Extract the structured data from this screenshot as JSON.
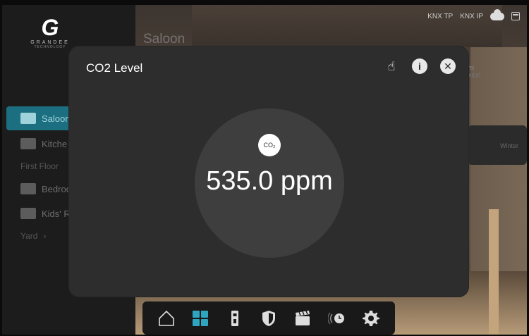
{
  "app": {
    "brand_mark": "G",
    "brand_name": "GRANDEE",
    "brand_tagline": "TECHNOLOGY",
    "status": {
      "knx_tp": "KNX TP",
      "knx_ip": "KNX IP"
    }
  },
  "background": {
    "room_title": "Saloon",
    "partial_label": "m",
    "partial_sublabel": "XIDE",
    "card_label": "Winter"
  },
  "sidebar": {
    "items": [
      {
        "label": "Saloon",
        "icon": "sofa-person-icon",
        "active": true
      },
      {
        "label": "Kitche",
        "icon": "kitchen-icon",
        "active": false
      }
    ],
    "sections": [
      {
        "label": "First Floor"
      }
    ],
    "items_first_floor": [
      {
        "label": "Bedroo",
        "icon": "bed-icon"
      },
      {
        "label": "Kids' R",
        "icon": "kids-icon"
      }
    ],
    "yard": {
      "label": "Yard",
      "chevron": "chevron-right-icon"
    },
    "accent": "#1c6f80"
  },
  "dock": {
    "items": [
      {
        "icon": "home-icon"
      },
      {
        "icon": "grid-icon",
        "active": true
      },
      {
        "icon": "door-panel-icon"
      },
      {
        "icon": "shield-icon"
      },
      {
        "icon": "clapperboard-icon"
      },
      {
        "icon": "schedule-icon"
      },
      {
        "icon": "gear-icon"
      }
    ]
  },
  "modal": {
    "title": "CO2 Level",
    "badge": "CO₂",
    "value": "535.0 ppm",
    "actions": [
      {
        "icon": "hand-pointer-icon"
      },
      {
        "icon": "info-icon",
        "glyph": "i"
      },
      {
        "icon": "close-icon",
        "glyph": "✕"
      }
    ]
  }
}
